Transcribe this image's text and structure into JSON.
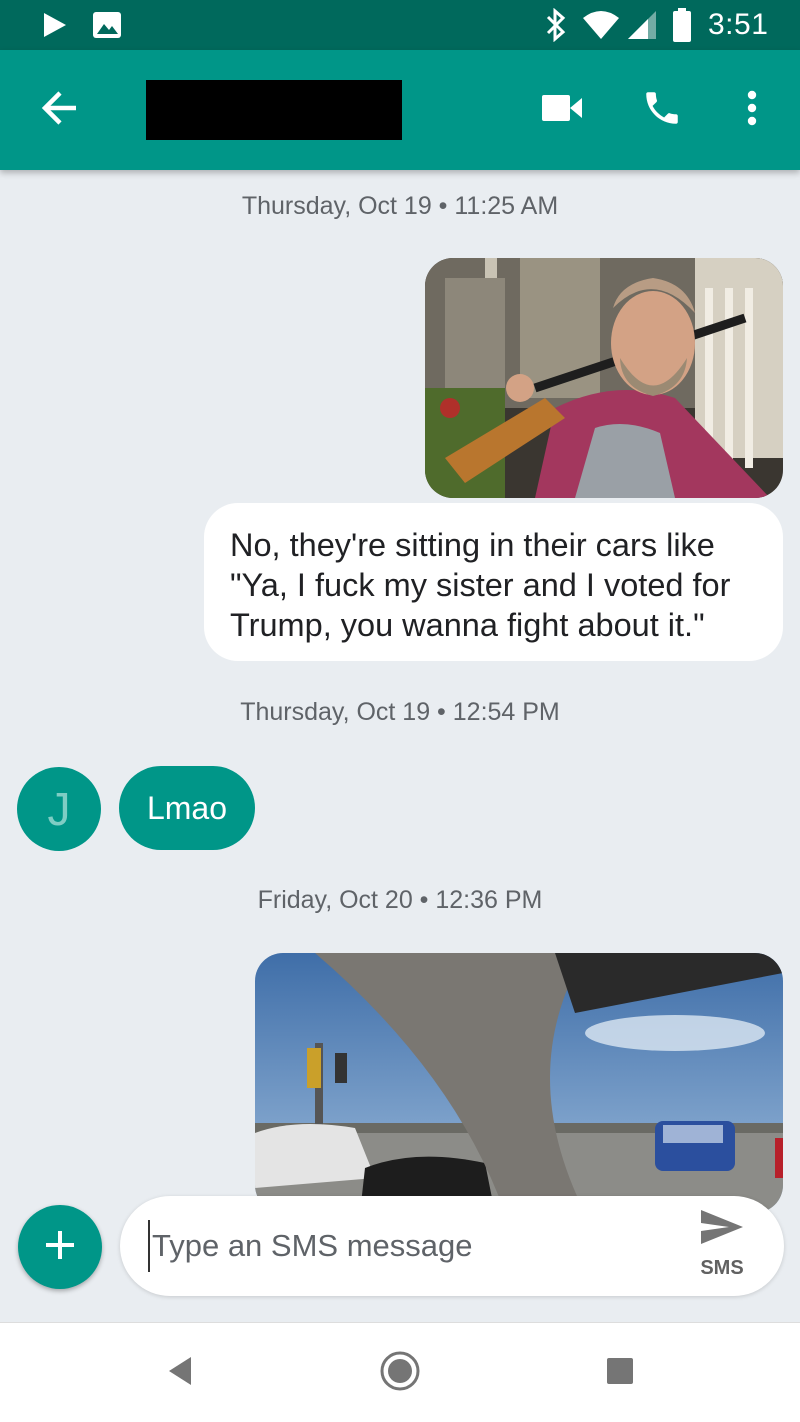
{
  "status_bar": {
    "time": "3:51",
    "icons": [
      "play-store-icon",
      "gallery-icon",
      "bluetooth-icon",
      "wifi-icon",
      "cellular-icon",
      "battery-icon"
    ]
  },
  "app_bar": {
    "contact_name": "",
    "icons": [
      "back-arrow-icon",
      "video-call-icon",
      "phone-icon",
      "more-vert-icon"
    ],
    "background_color": "#009688"
  },
  "conversation": {
    "timestamp_1": "Thursday, Oct 19 • 11:25 AM",
    "outgoing_photo_1": "photo-man-with-shotgun",
    "outgoing_message": "No, they're sitting in their cars like \"Ya, I fuck my sister and I voted for Trump, you wanna fight about it.\"",
    "timestamp_2": "Thursday, Oct 19 • 12:54 PM",
    "avatar_initial": "J",
    "incoming_message": "Lmao",
    "timestamp_3": "Friday, Oct 20 • 12:36 PM",
    "outgoing_photo_2": "photo-view-from-car"
  },
  "compose": {
    "placeholder": "Type an SMS message",
    "send_label": "SMS"
  },
  "nav_bar": {
    "icons": [
      "nav-back-icon",
      "nav-home-icon",
      "nav-recents-icon"
    ]
  },
  "colors": {
    "status_bar": "#00695c",
    "accent": "#009688",
    "background": "#e9edf1"
  }
}
